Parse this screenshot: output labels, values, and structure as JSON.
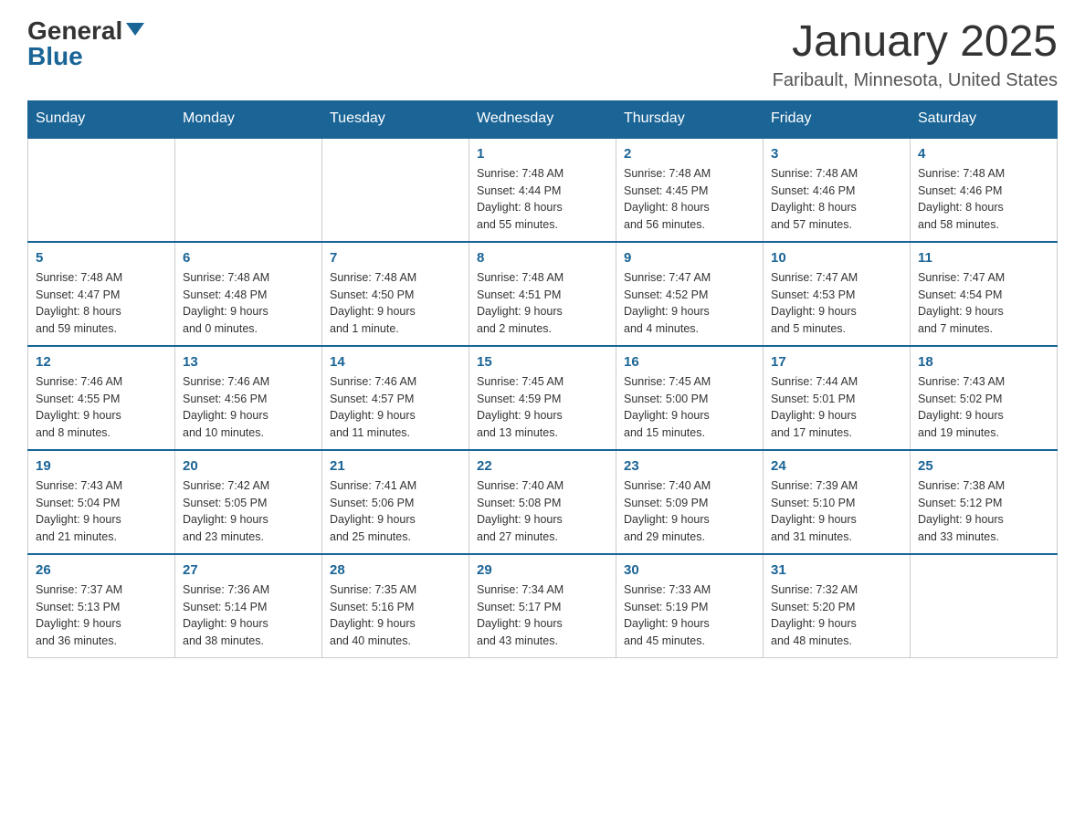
{
  "header": {
    "logo_general": "General",
    "logo_blue": "Blue",
    "title": "January 2025",
    "subtitle": "Faribault, Minnesota, United States"
  },
  "days_of_week": [
    "Sunday",
    "Monday",
    "Tuesday",
    "Wednesday",
    "Thursday",
    "Friday",
    "Saturday"
  ],
  "weeks": [
    [
      {
        "day": "",
        "info": ""
      },
      {
        "day": "",
        "info": ""
      },
      {
        "day": "",
        "info": ""
      },
      {
        "day": "1",
        "info": "Sunrise: 7:48 AM\nSunset: 4:44 PM\nDaylight: 8 hours\nand 55 minutes."
      },
      {
        "day": "2",
        "info": "Sunrise: 7:48 AM\nSunset: 4:45 PM\nDaylight: 8 hours\nand 56 minutes."
      },
      {
        "day": "3",
        "info": "Sunrise: 7:48 AM\nSunset: 4:46 PM\nDaylight: 8 hours\nand 57 minutes."
      },
      {
        "day": "4",
        "info": "Sunrise: 7:48 AM\nSunset: 4:46 PM\nDaylight: 8 hours\nand 58 minutes."
      }
    ],
    [
      {
        "day": "5",
        "info": "Sunrise: 7:48 AM\nSunset: 4:47 PM\nDaylight: 8 hours\nand 59 minutes."
      },
      {
        "day": "6",
        "info": "Sunrise: 7:48 AM\nSunset: 4:48 PM\nDaylight: 9 hours\nand 0 minutes."
      },
      {
        "day": "7",
        "info": "Sunrise: 7:48 AM\nSunset: 4:50 PM\nDaylight: 9 hours\nand 1 minute."
      },
      {
        "day": "8",
        "info": "Sunrise: 7:48 AM\nSunset: 4:51 PM\nDaylight: 9 hours\nand 2 minutes."
      },
      {
        "day": "9",
        "info": "Sunrise: 7:47 AM\nSunset: 4:52 PM\nDaylight: 9 hours\nand 4 minutes."
      },
      {
        "day": "10",
        "info": "Sunrise: 7:47 AM\nSunset: 4:53 PM\nDaylight: 9 hours\nand 5 minutes."
      },
      {
        "day": "11",
        "info": "Sunrise: 7:47 AM\nSunset: 4:54 PM\nDaylight: 9 hours\nand 7 minutes."
      }
    ],
    [
      {
        "day": "12",
        "info": "Sunrise: 7:46 AM\nSunset: 4:55 PM\nDaylight: 9 hours\nand 8 minutes."
      },
      {
        "day": "13",
        "info": "Sunrise: 7:46 AM\nSunset: 4:56 PM\nDaylight: 9 hours\nand 10 minutes."
      },
      {
        "day": "14",
        "info": "Sunrise: 7:46 AM\nSunset: 4:57 PM\nDaylight: 9 hours\nand 11 minutes."
      },
      {
        "day": "15",
        "info": "Sunrise: 7:45 AM\nSunset: 4:59 PM\nDaylight: 9 hours\nand 13 minutes."
      },
      {
        "day": "16",
        "info": "Sunrise: 7:45 AM\nSunset: 5:00 PM\nDaylight: 9 hours\nand 15 minutes."
      },
      {
        "day": "17",
        "info": "Sunrise: 7:44 AM\nSunset: 5:01 PM\nDaylight: 9 hours\nand 17 minutes."
      },
      {
        "day": "18",
        "info": "Sunrise: 7:43 AM\nSunset: 5:02 PM\nDaylight: 9 hours\nand 19 minutes."
      }
    ],
    [
      {
        "day": "19",
        "info": "Sunrise: 7:43 AM\nSunset: 5:04 PM\nDaylight: 9 hours\nand 21 minutes."
      },
      {
        "day": "20",
        "info": "Sunrise: 7:42 AM\nSunset: 5:05 PM\nDaylight: 9 hours\nand 23 minutes."
      },
      {
        "day": "21",
        "info": "Sunrise: 7:41 AM\nSunset: 5:06 PM\nDaylight: 9 hours\nand 25 minutes."
      },
      {
        "day": "22",
        "info": "Sunrise: 7:40 AM\nSunset: 5:08 PM\nDaylight: 9 hours\nand 27 minutes."
      },
      {
        "day": "23",
        "info": "Sunrise: 7:40 AM\nSunset: 5:09 PM\nDaylight: 9 hours\nand 29 minutes."
      },
      {
        "day": "24",
        "info": "Sunrise: 7:39 AM\nSunset: 5:10 PM\nDaylight: 9 hours\nand 31 minutes."
      },
      {
        "day": "25",
        "info": "Sunrise: 7:38 AM\nSunset: 5:12 PM\nDaylight: 9 hours\nand 33 minutes."
      }
    ],
    [
      {
        "day": "26",
        "info": "Sunrise: 7:37 AM\nSunset: 5:13 PM\nDaylight: 9 hours\nand 36 minutes."
      },
      {
        "day": "27",
        "info": "Sunrise: 7:36 AM\nSunset: 5:14 PM\nDaylight: 9 hours\nand 38 minutes."
      },
      {
        "day": "28",
        "info": "Sunrise: 7:35 AM\nSunset: 5:16 PM\nDaylight: 9 hours\nand 40 minutes."
      },
      {
        "day": "29",
        "info": "Sunrise: 7:34 AM\nSunset: 5:17 PM\nDaylight: 9 hours\nand 43 minutes."
      },
      {
        "day": "30",
        "info": "Sunrise: 7:33 AM\nSunset: 5:19 PM\nDaylight: 9 hours\nand 45 minutes."
      },
      {
        "day": "31",
        "info": "Sunrise: 7:32 AM\nSunset: 5:20 PM\nDaylight: 9 hours\nand 48 minutes."
      },
      {
        "day": "",
        "info": ""
      }
    ]
  ]
}
